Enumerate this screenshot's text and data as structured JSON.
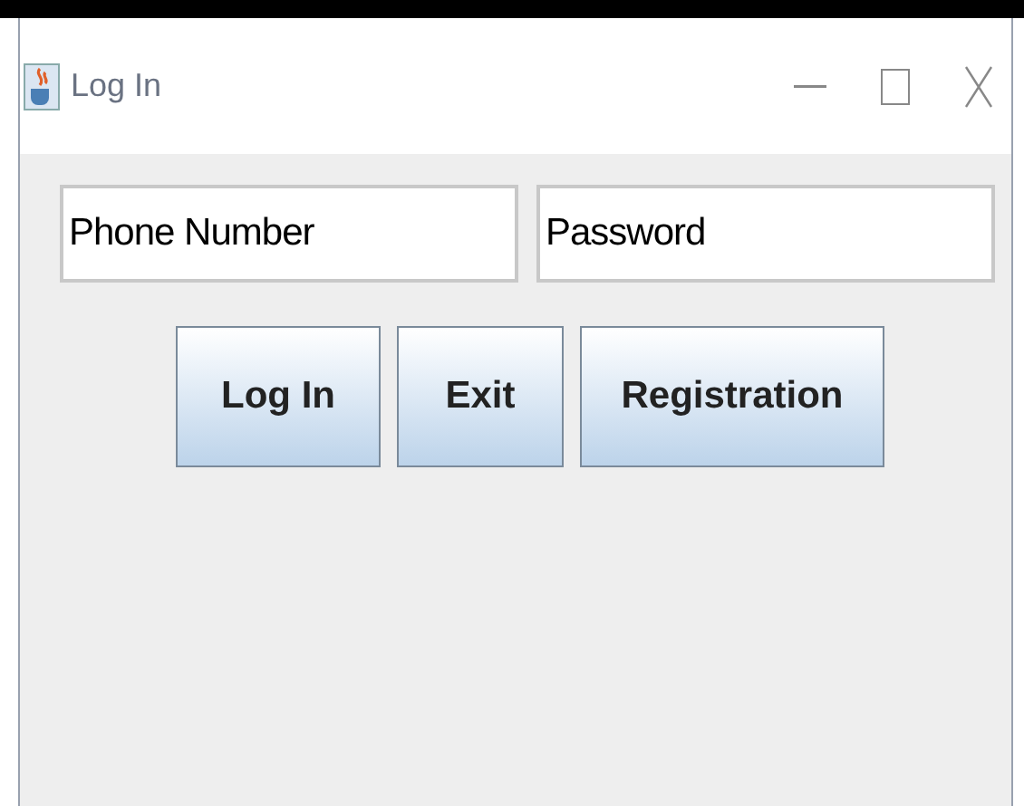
{
  "window": {
    "title": "Log In"
  },
  "fields": [
    {
      "value": "Phone Number"
    },
    {
      "value": "Password"
    }
  ],
  "buttons": [
    "Log In",
    "Exit",
    "Registration"
  ]
}
